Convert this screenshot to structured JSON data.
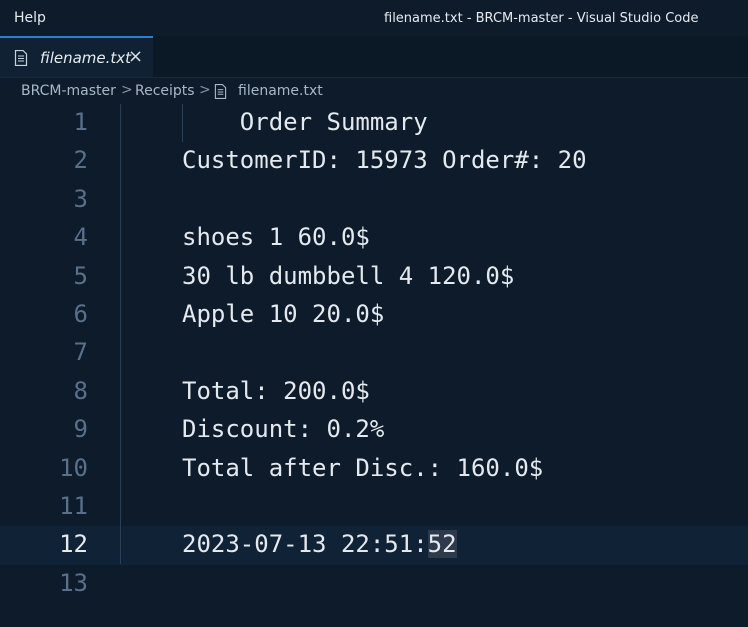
{
  "titlebar": {
    "menu_help": "Help",
    "window_title": "filename.txt - BRCM-master - Visual Studio Code"
  },
  "tabs": [
    {
      "label": "filename.txt",
      "icon": "file-lines-icon",
      "close": "×"
    }
  ],
  "breadcrumb": {
    "items": [
      "BRCM-master",
      "Receipts",
      "filename.txt"
    ],
    "separator": ">"
  },
  "editor": {
    "current_line": 12,
    "lines": [
      {
        "num": "1",
        "text": "    Order Summary"
      },
      {
        "num": "2",
        "text": "CustomerID: 15973 Order#: 20"
      },
      {
        "num": "3",
        "text": ""
      },
      {
        "num": "4",
        "text": "shoes 1 60.0$"
      },
      {
        "num": "5",
        "text": "30 lb dumbbell 4 120.0$"
      },
      {
        "num": "6",
        "text": "Apple 10 20.0$"
      },
      {
        "num": "7",
        "text": ""
      },
      {
        "num": "8",
        "text": "Total: 200.0$"
      },
      {
        "num": "9",
        "text": "Discount: 0.2%"
      },
      {
        "num": "10",
        "text": "Total after Disc.: 160.0$"
      },
      {
        "num": "11",
        "text": ""
      },
      {
        "num": "12",
        "text_before_selection": "2023-07-13 22:51:",
        "selected_text": "52"
      },
      {
        "num": "13",
        "text": ""
      }
    ]
  },
  "colors": {
    "background": "#0d1b2a",
    "tab_accent": "#2f7fd1",
    "line_number": "#59708a",
    "text": "#e3e9ef"
  }
}
